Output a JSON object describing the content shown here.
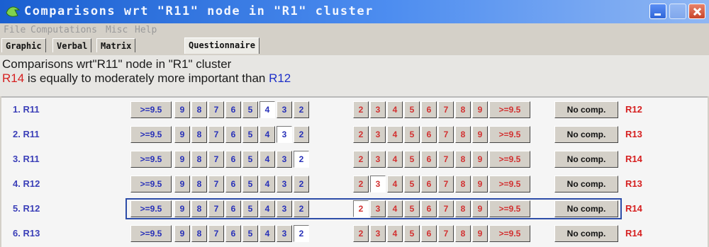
{
  "window": {
    "title": "Comparisons wrt \"R11\" node in \"R1\" cluster",
    "menu": [
      "File",
      "Computations",
      "Misc",
      "Help"
    ],
    "tabs": [
      "Graphic",
      "Verbal",
      "Matrix",
      "Questionnaire"
    ],
    "active_tab": "Questionnaire"
  },
  "description": {
    "line1": "Comparisons wrt\"R11\" node in \"R1\" cluster",
    "line2_left": "R14",
    "line2_middle": " is equally to moderately more important than ",
    "line2_right": "R12"
  },
  "scale": {
    "left": [
      ">=9.5",
      "9",
      "8",
      "7",
      "6",
      "5",
      "4",
      "3",
      "2"
    ],
    "right": [
      "2",
      "3",
      "4",
      "5",
      "6",
      "7",
      "8",
      "9",
      ">=9.5"
    ],
    "no_comp": "No comp."
  },
  "rows": [
    {
      "label": "1.  R11",
      "right": "R12",
      "selected": "left-4"
    },
    {
      "label": "2.  R11",
      "right": "R13",
      "selected": "left-3"
    },
    {
      "label": "3.  R11",
      "right": "R14",
      "selected": "left-2"
    },
    {
      "label": "4.  R12",
      "right": "R13",
      "selected": "right-3"
    },
    {
      "label": "5.  R12",
      "right": "R14",
      "selected": "right-2",
      "focused": true
    },
    {
      "label": "6.  R13",
      "right": "R14",
      "selected": "left-2"
    }
  ],
  "colors": {
    "title_bar": "#1a5fd0",
    "left_text": "#2730b8",
    "right_text": "#d23030",
    "focus_border": "#2d4da8"
  }
}
